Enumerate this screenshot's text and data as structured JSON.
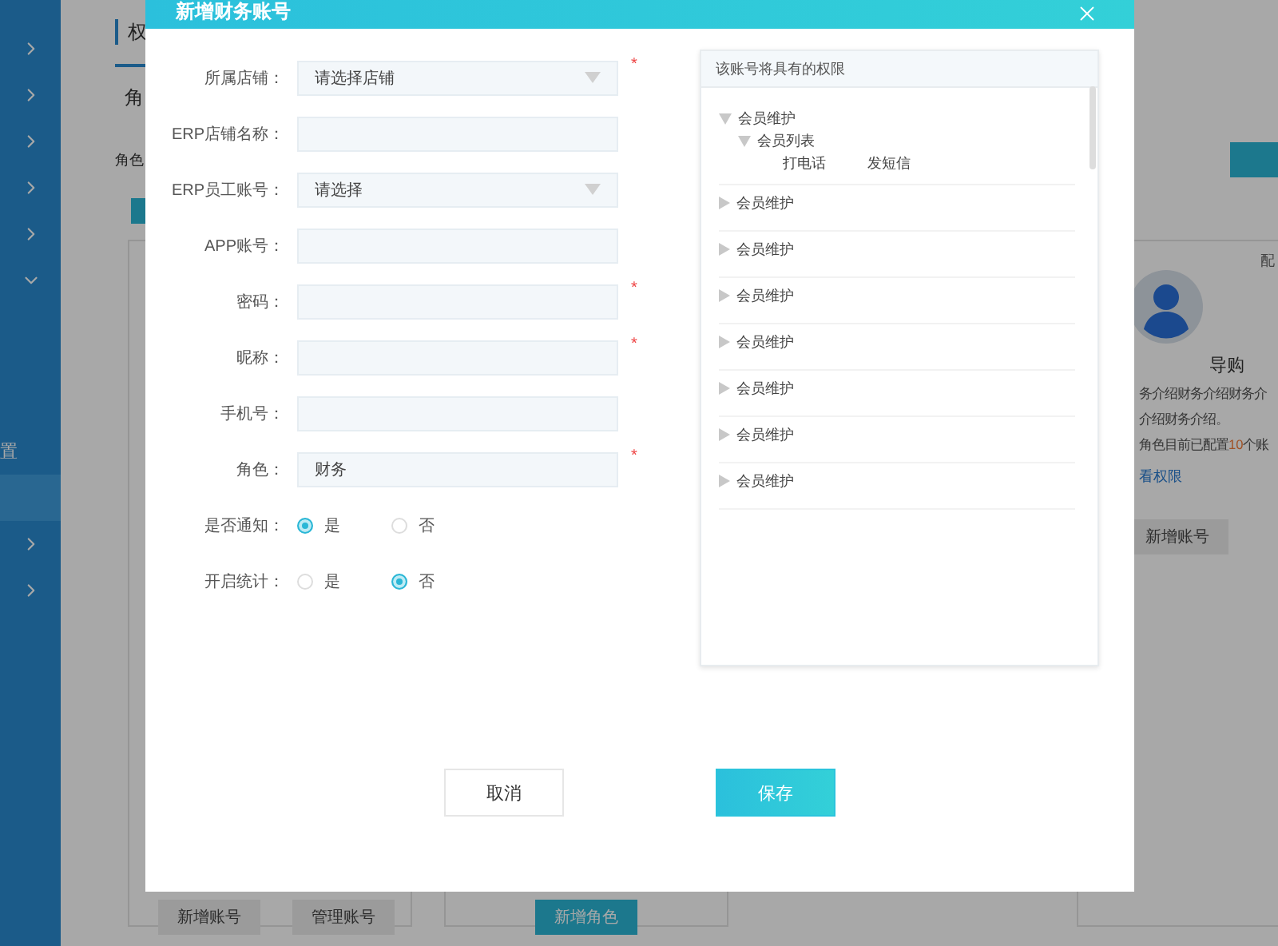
{
  "sidebar": {
    "items": [
      {
        "kind": "group",
        "expanded": false
      },
      {
        "kind": "group",
        "expanded": false
      },
      {
        "kind": "group",
        "expanded": false
      },
      {
        "kind": "group",
        "expanded": false
      },
      {
        "kind": "group",
        "expanded": false
      },
      {
        "kind": "group",
        "expanded": true
      },
      {
        "kind": "link",
        "label": "置",
        "selected": false
      },
      {
        "kind": "link",
        "selected": true
      },
      {
        "kind": "group",
        "expanded": false
      },
      {
        "kind": "group",
        "expanded": false
      }
    ]
  },
  "page": {
    "title": "权",
    "tab": "角",
    "filter_label": "角色",
    "cards": [
      {
        "buttons": [
          {
            "label": "新增账号",
            "primary": false
          },
          {
            "label": "管理账号",
            "primary": false
          }
        ]
      },
      {
        "buttons": [
          {
            "label": "新增角色",
            "primary": true
          }
        ]
      },
      {
        "corner": "配",
        "name": "导购",
        "description": [
          "务介绍财务介绍财务介",
          "介绍财务介绍。"
        ],
        "count_prefix": "角色目前已配置",
        "count": "10",
        "count_suffix": "个账",
        "link": "看权限",
        "buttons": [
          {
            "label": "新增账号",
            "primary": false
          }
        ]
      }
    ]
  },
  "dialog": {
    "title": "新增财务账号",
    "fields": [
      {
        "kind": "select",
        "label": "所属店铺：",
        "placeholder": "请选择店铺",
        "required_mark": "*"
      },
      {
        "kind": "input",
        "label": "ERP店铺名称："
      },
      {
        "kind": "select",
        "label": "ERP员工账号：",
        "placeholder": "请选择"
      },
      {
        "kind": "input",
        "label": "APP账号："
      },
      {
        "kind": "input",
        "label": "密码：",
        "required_mark": "*"
      },
      {
        "kind": "input",
        "label": "昵称：",
        "required_mark": "*"
      },
      {
        "kind": "input",
        "label": "手机号："
      },
      {
        "kind": "input",
        "label": "角色：",
        "value": "财务",
        "required_mark": "*"
      },
      {
        "kind": "radio",
        "label": "是否通知：",
        "options": [
          {
            "label": "是",
            "selected": true
          },
          {
            "label": "否",
            "selected": false
          }
        ]
      },
      {
        "kind": "radio",
        "label": "开启统计：",
        "options": [
          {
            "label": "是",
            "selected": false
          },
          {
            "label": "否",
            "selected": true
          }
        ]
      }
    ],
    "permissions": {
      "title": "该账号将具有的权限",
      "tree": [
        {
          "label": "会员维护",
          "expanded": true,
          "children": [
            {
              "label": "会员列表",
              "expanded": true,
              "children": [
                {
                  "label": "打电话"
                },
                {
                  "label": "发短信"
                }
              ]
            }
          ]
        },
        {
          "label": "会员维护",
          "expanded": false
        },
        {
          "label": "会员维护",
          "expanded": false
        },
        {
          "label": "会员维护",
          "expanded": false
        },
        {
          "label": "会员维护",
          "expanded": false
        },
        {
          "label": "会员维护",
          "expanded": false
        },
        {
          "label": "会员维护",
          "expanded": false
        },
        {
          "label": "会员维护",
          "expanded": false
        }
      ]
    },
    "buttons": [
      {
        "label": "取消",
        "primary": false
      },
      {
        "label": "保存",
        "primary": true
      }
    ]
  }
}
